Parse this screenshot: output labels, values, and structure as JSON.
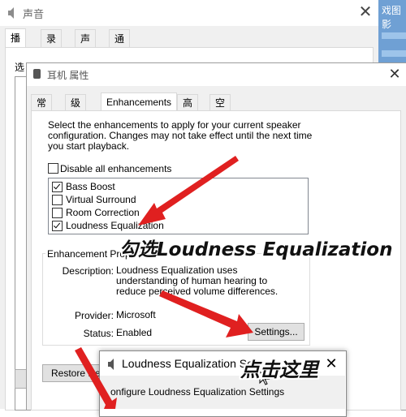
{
  "sound_window": {
    "title": "声音",
    "tabs": [
      "播放",
      "录制",
      "声音",
      "通信"
    ],
    "partial_label": "选"
  },
  "desktop": {
    "partial_text": "戏图影"
  },
  "props_window": {
    "title": "耳机 属性",
    "tabs": [
      "常规",
      "级别",
      "Enhancements",
      "高级",
      "空间音效"
    ],
    "description": "Select the enhancements to apply for your current speaker configuration. Changes may not take effect until the next time you start playback.",
    "disable_all_label": "Disable all enhancements",
    "enhancements": [
      {
        "label": "Bass Boost",
        "checked": true
      },
      {
        "label": "Virtual Surround",
        "checked": false
      },
      {
        "label": "Room Correction",
        "checked": false
      },
      {
        "label": "Loudness Equalization",
        "checked": true
      }
    ],
    "group_title": "Enhancement Properti",
    "description_label": "Description:",
    "description_value": "Loudness Equalization uses understanding of human hearing to reduce perceived volume differences.",
    "provider_label": "Provider:",
    "provider_value": "Microsoft",
    "status_label": "Status:",
    "status_value": "Enabled",
    "settings_button": "Settings...",
    "restore_button": "Restore Defa"
  },
  "popup": {
    "title": "Loudness Equalization Se",
    "body_text": "onfigure Loudness Equalization Settings"
  },
  "annotations": {
    "check_loudness": "勾选Loudness Equalization",
    "click_here": "点击这里"
  },
  "colors": {
    "arrow": "#e02020",
    "desktop": "#6fa0d4"
  }
}
